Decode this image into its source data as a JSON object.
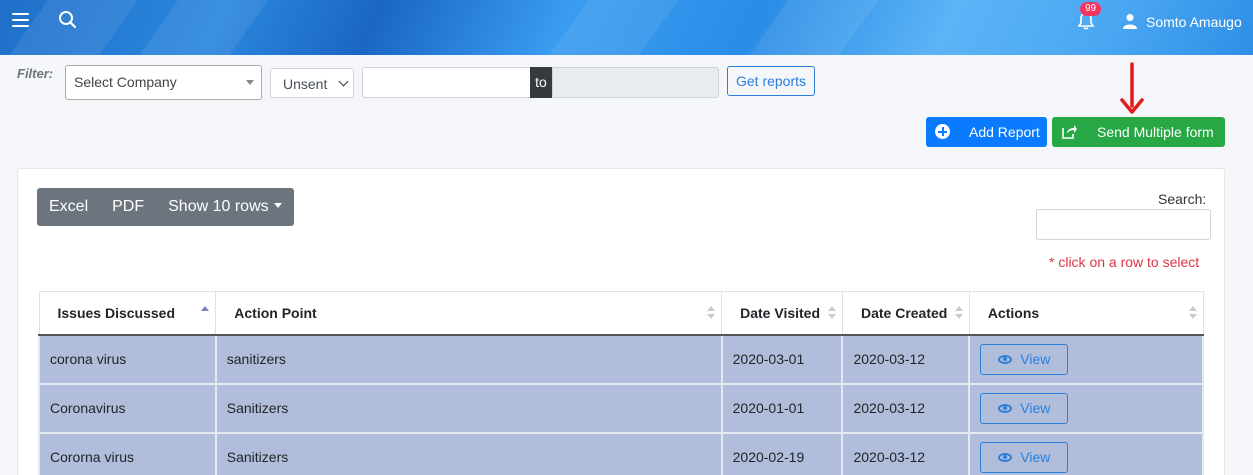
{
  "header": {
    "notification_count": "99",
    "user_name": "Somto Amaugo"
  },
  "filter": {
    "label": "Filter:",
    "company_select": "Select Company",
    "status_select": "Unsent",
    "date_separator": "to",
    "get_reports_label": "Get reports"
  },
  "actions": {
    "add_report_label": "Add Report",
    "send_multiple_label": "Send Multiple form"
  },
  "datatable": {
    "buttons": [
      "Excel",
      "PDF",
      "Show 10 rows"
    ],
    "search_label": "Search:",
    "hint": "* click on a row to select",
    "columns": [
      "Issues Discussed",
      "Action Point",
      "Date Visited",
      "Date Created",
      "Actions"
    ],
    "rows": [
      {
        "issue": "corona virus",
        "action_point": "sanitizers",
        "date_visited": "2020-03-01",
        "date_created": "2020-03-12",
        "action_label": "View"
      },
      {
        "issue": "Coronavirus",
        "action_point": "Sanitizers",
        "date_visited": "2020-01-01",
        "date_created": "2020-03-12",
        "action_label": "View"
      },
      {
        "issue": "Cororna virus",
        "action_point": "Sanitizers",
        "date_visited": "2020-02-19",
        "date_created": "2020-03-12",
        "action_label": "View"
      }
    ]
  },
  "colors": {
    "primary": "#0a7bff",
    "success": "#28a745",
    "selected_row": "#b1bedb",
    "danger": "#dc3545"
  }
}
